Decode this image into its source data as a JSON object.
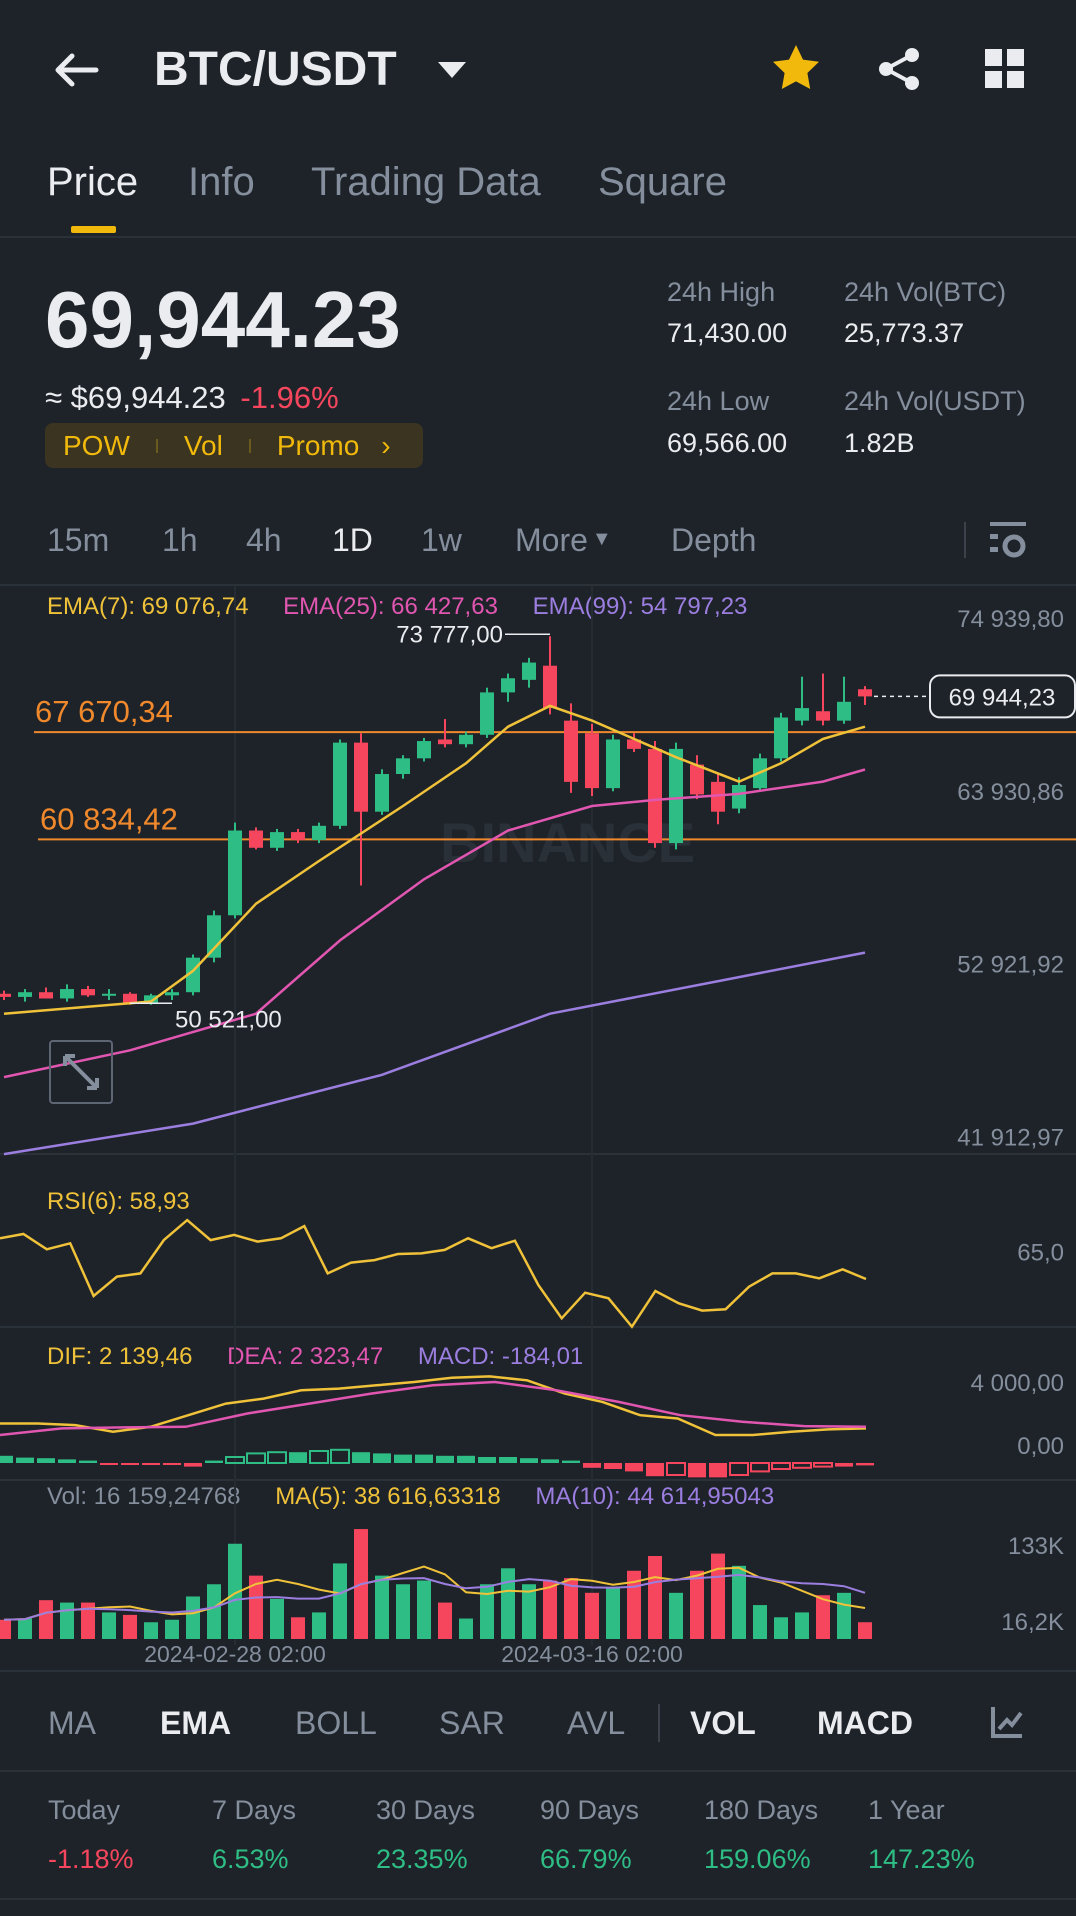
{
  "header": {
    "title": "BTC/USDT",
    "icons": [
      "back-arrow-icon",
      "caret-down-icon",
      "star-icon",
      "share-icon",
      "grid-icon"
    ]
  },
  "tabs": [
    {
      "label": "Price",
      "active": true
    },
    {
      "label": "Info"
    },
    {
      "label": "Trading Data"
    },
    {
      "label": "Square"
    }
  ],
  "price": {
    "last": "69,944.23",
    "approx": "≈ $69,944.23",
    "change": "-1.96%",
    "tags": [
      "POW",
      "Vol",
      "Promo"
    ],
    "stats": {
      "high_label": "24h High",
      "high": "71,430.00",
      "low_label": "24h Low",
      "low": "69,566.00",
      "vol_btc_label": "24h Vol(BTC)",
      "vol_btc": "25,773.37",
      "vol_usdt_label": "24h Vol(USDT)",
      "vol_usdt": "1.82B"
    }
  },
  "timeframes": [
    "15m",
    "1h",
    "4h",
    "1D",
    "1w",
    "More",
    "Depth"
  ],
  "active_timeframe": "1D",
  "colors": {
    "bg": "#1e2329",
    "up": "#2ebd85",
    "down": "#f6465d",
    "yellow": "#f0b90b",
    "ema7": "#f0c23a",
    "ema25": "#e056b0",
    "ema99": "#9b7ee0",
    "level": "#f0882c"
  },
  "chart_data": {
    "type": "candlestick",
    "legend": {
      "ema7": "EMA(7): 69 076,74",
      "ema25": "EMA(25): 66 427,63",
      "ema99": "EMA(99): 54 797,23"
    },
    "y_ticks": [
      "74 939,80",
      "63 930,86",
      "52 921,92",
      "41 912,97"
    ],
    "y_tick_values": [
      74939.8,
      63930.86,
      52921.92,
      41912.97
    ],
    "levels": [
      {
        "label": "67 670,34",
        "value": 67670.34
      },
      {
        "label": "60 834,42",
        "value": 60834.42
      }
    ],
    "high_label": "73 777,00",
    "high_value": 73777,
    "high_index": 26,
    "low_label": "50 521,00",
    "low_value": 50521,
    "low_index": 6,
    "current_label": "69 944,23",
    "current_value": 69944.23,
    "watermark": "BINANCE",
    "x_labels": [
      {
        "label": "2024-02-28 02:00",
        "index": 11
      },
      {
        "label": "2024-03-16 02:00",
        "index": 28
      }
    ],
    "candles": [
      [
        51000,
        51200,
        50600,
        50800
      ],
      [
        50800,
        51300,
        50500,
        51100
      ],
      [
        51100,
        51400,
        50700,
        50700
      ],
      [
        50700,
        51600,
        50500,
        51300
      ],
      [
        51300,
        51500,
        50800,
        50900
      ],
      [
        50900,
        51300,
        50600,
        51000
      ],
      [
        51000,
        51100,
        50300,
        50400
      ],
      [
        50400,
        51000,
        50300,
        50900
      ],
      [
        50900,
        51300,
        50600,
        51100
      ],
      [
        51100,
        53500,
        50900,
        53300
      ],
      [
        53300,
        56300,
        53000,
        56000
      ],
      [
        56000,
        61900,
        55800,
        61400
      ],
      [
        61400,
        61600,
        60200,
        60300
      ],
      [
        60300,
        61500,
        60100,
        61300
      ],
      [
        61300,
        61500,
        60600,
        60800
      ],
      [
        60800,
        61900,
        60600,
        61700
      ],
      [
        61700,
        67200,
        61500,
        67000
      ],
      [
        67000,
        67600,
        57900,
        62600
      ],
      [
        62600,
        65300,
        62400,
        65000
      ],
      [
        65000,
        66200,
        64700,
        66000
      ],
      [
        66000,
        67300,
        65800,
        67100
      ],
      [
        67200,
        68500,
        66700,
        66900
      ],
      [
        66900,
        67700,
        66700,
        67500
      ],
      [
        67500,
        70500,
        67300,
        70200
      ],
      [
        70200,
        71400,
        69600,
        71100
      ],
      [
        71000,
        72400,
        70500,
        72100
      ],
      [
        71900,
        73777,
        68800,
        69200
      ],
      [
        68400,
        69500,
        63800,
        64500
      ],
      [
        67600,
        68200,
        63600,
        64100
      ],
      [
        64100,
        67500,
        63900,
        67200
      ],
      [
        67200,
        67600,
        66400,
        66600
      ],
      [
        66600,
        67100,
        60300,
        60600
      ],
      [
        60600,
        67000,
        60200,
        66600
      ],
      [
        65600,
        66200,
        63400,
        63700
      ],
      [
        64500,
        65000,
        61800,
        62600
      ],
      [
        62800,
        64800,
        62500,
        64300
      ],
      [
        64100,
        66300,
        63900,
        66000
      ],
      [
        66000,
        68900,
        65800,
        68600
      ],
      [
        68400,
        71200,
        68100,
        69200
      ],
      [
        69000,
        71400,
        68100,
        68400
      ],
      [
        68400,
        71200,
        68200,
        69600
      ],
      [
        70400,
        70600,
        69400,
        69944
      ]
    ],
    "ema7": [
      [
        0,
        49730
      ],
      [
        7,
        50510
      ],
      [
        9,
        52455
      ],
      [
        12,
        56735
      ],
      [
        15,
        59460
      ],
      [
        19,
        62960
      ],
      [
        22,
        65680
      ],
      [
        24,
        68015
      ],
      [
        26,
        69340
      ],
      [
        28,
        68405
      ],
      [
        30,
        67240
      ],
      [
        32,
        66070
      ],
      [
        35,
        64515
      ],
      [
        37,
        65680
      ],
      [
        39,
        67240
      ],
      [
        41,
        68015
      ]
    ],
    "ema25": [
      [
        0,
        45690
      ],
      [
        6,
        47400
      ],
      [
        12,
        49730
      ],
      [
        16,
        54400
      ],
      [
        20,
        58290
      ],
      [
        24,
        61400
      ],
      [
        28,
        62960
      ],
      [
        31,
        63350
      ],
      [
        35,
        63736
      ],
      [
        39,
        64515
      ],
      [
        41,
        65290
      ]
    ],
    "ema99": [
      [
        0,
        40785
      ],
      [
        9,
        42730
      ],
      [
        18,
        45840
      ],
      [
        26,
        49730
      ],
      [
        35,
        52060
      ],
      [
        41,
        53620
      ]
    ],
    "rsi": {
      "label": "RSI(6): 58,93",
      "tick": "65,0",
      "tick_value": 65,
      "values": [
        71.2,
        73.2,
        66.1,
        68.9,
        44.4,
        53.4,
        54.9,
        70.4,
        79.7,
        70.4,
        72.8,
        69.7,
        71.2,
        76.9,
        54.9,
        59.9,
        61.1,
        63.9,
        64.2,
        65.8,
        71.2,
        66.6,
        70.1,
        49.5,
        34.0,
        45.9,
        43.3,
        30.1,
        46.7,
        41.0,
        37.6,
        38.2,
        48.7,
        54.9,
        54.9,
        52.6,
        56.8,
        52.3
      ]
    },
    "macd": {
      "dif_label": "DIF: 2 139,46",
      "dea_label": "DEA: 2 323,47",
      "macd_label": "MACD: -184,01",
      "ticks": [
        "4 000,00",
        "0,00"
      ],
      "tick_values": [
        4000,
        0
      ],
      "dif": [
        1368,
        1368,
        1263,
        842,
        1158,
        1895,
        2631,
        2947,
        3473,
        3578,
        3789,
        4000,
        4274,
        4358,
        4105,
        3263,
        2737,
        1895,
        1684,
        632,
        632,
        842,
        989,
        1052
      ],
      "dea": [
        632,
        1052,
        1115,
        1158,
        2000,
        2631,
        3263,
        3789,
        4000,
        3473,
        2737,
        1895,
        1473,
        1200,
        1158
      ],
      "hist": [
        600,
        450,
        400,
        300,
        200,
        -150,
        -150,
        -150,
        -150,
        -300,
        200,
        500,
        800,
        900,
        900,
        1000,
        1100,
        900,
        800,
        700,
        700,
        600,
        600,
        500,
        500,
        400,
        300,
        200,
        -400,
        -500,
        -700,
        -1100,
        -1000,
        -1200,
        -1200,
        -1000,
        -700,
        -500,
        -400,
        -300,
        -300,
        -200
      ]
    },
    "volume": {
      "vol_label": "Vol: 16 159,24768",
      "ma5_label": "MA(5): 38 616,63318",
      "ma10_label": "MA(10): 44 614,95043",
      "ticks": [
        "133K",
        "16,2K"
      ],
      "tick_values_k": [
        133,
        16.2
      ],
      "values_k": [
        18.1,
        20.0,
        48.2,
        44.5,
        44.5,
        29.4,
        25.6,
        14.3,
        18.1,
        53.9,
        72.7,
        134.9,
        85.9,
        50.1,
        21.9,
        29.4,
        104.7,
        157.5,
        85.9,
        72.7,
        78.4,
        44.5,
        20.0,
        72.7,
        97.2,
        72.7,
        78.4,
        82.1,
        59.5,
        67.1,
        93.4,
        116.1,
        59.5,
        93.4,
        119.8,
        101.0,
        40.7,
        21.9,
        29.4,
        55.8,
        59.5,
        14.3
      ]
    }
  },
  "indicators": {
    "main": [
      "MA",
      "EMA",
      "BOLL",
      "SAR",
      "AVL"
    ],
    "sub": [
      "VOL",
      "MACD"
    ],
    "active": [
      "EMA",
      "VOL",
      "MACD"
    ]
  },
  "performance": [
    {
      "label": "Today",
      "value": "-1.18%"
    },
    {
      "label": "7 Days",
      "value": "6.53%"
    },
    {
      "label": "30 Days",
      "value": "23.35%"
    },
    {
      "label": "90 Days",
      "value": "66.79%"
    },
    {
      "label": "180 Days",
      "value": "159.06%"
    },
    {
      "label": "1 Year",
      "value": "147.23%"
    }
  ]
}
